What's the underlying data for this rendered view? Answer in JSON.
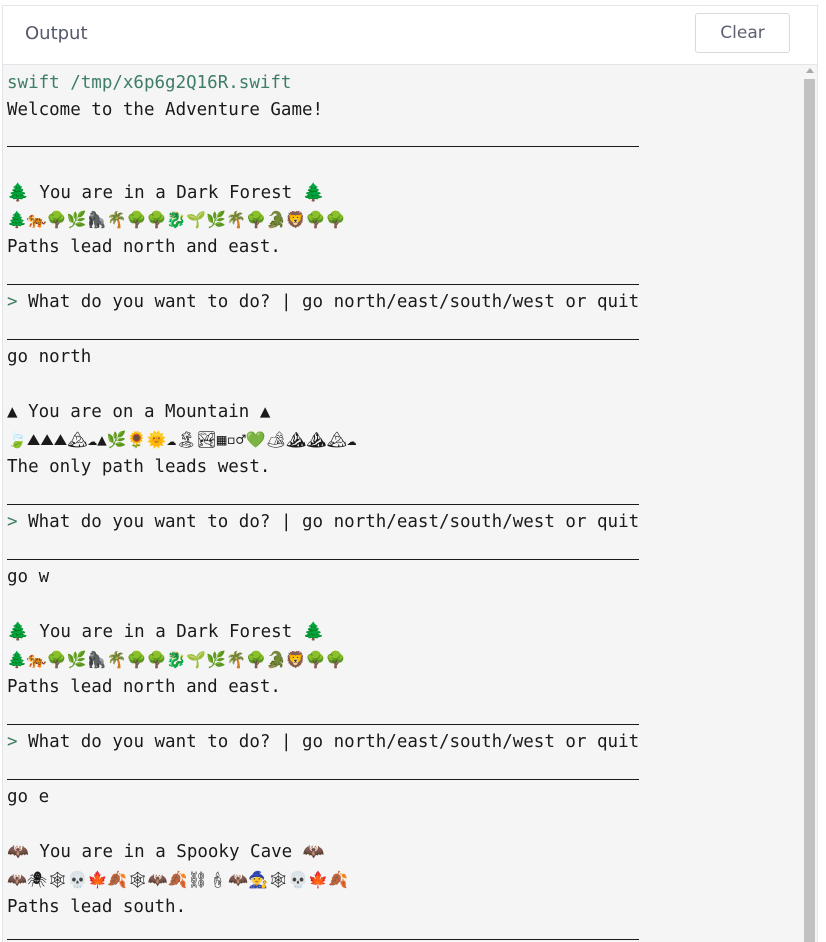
{
  "header": {
    "title": "Output",
    "clear_label": "Clear"
  },
  "console": {
    "command": "swift /tmp/x6p6g2Q16R.swift",
    "welcome": "Welcome to the Adventure Game!",
    "blocks": [
      {
        "location": "🌲 You are in a Dark Forest 🌲",
        "emoji": "🌲🐅🌳🌿🦍🌴🌳🌳🐉🌱🌿🌴🌳🐊🦁🌳🌳",
        "paths": "Paths lead north and east."
      },
      {
        "location": "▲ You are on a Mountain ▲",
        "emoji": "🍃⛰⛰⛰🏔☁▲🌿🌻🌞☁🏝🏞▦▫♂💚🏕⛰⛰🏔☁",
        "paths": "The only path leads west."
      },
      {
        "location": "🌲 You are in a Dark Forest 🌲",
        "emoji": "🌲🐅🌳🌿🦍🌴🌳🌳🐉🌱🌿🌴🌳🐊🦁🌳🌳",
        "paths": "Paths lead north and east."
      },
      {
        "location": "🦇 You are in a Spooky Cave 🦇",
        "emoji": "🦇🕷🕸💀🍁🍂🕸🦇🍂⛓🕯🦇🧙🕸💀🍁🍂",
        "paths": "Paths lead south."
      }
    ],
    "prompt_symbol": ">",
    "prompt_text": " What do you want to do? | go north/east/south/west or quit",
    "inputs": [
      "go north",
      "go w",
      "go e"
    ]
  }
}
